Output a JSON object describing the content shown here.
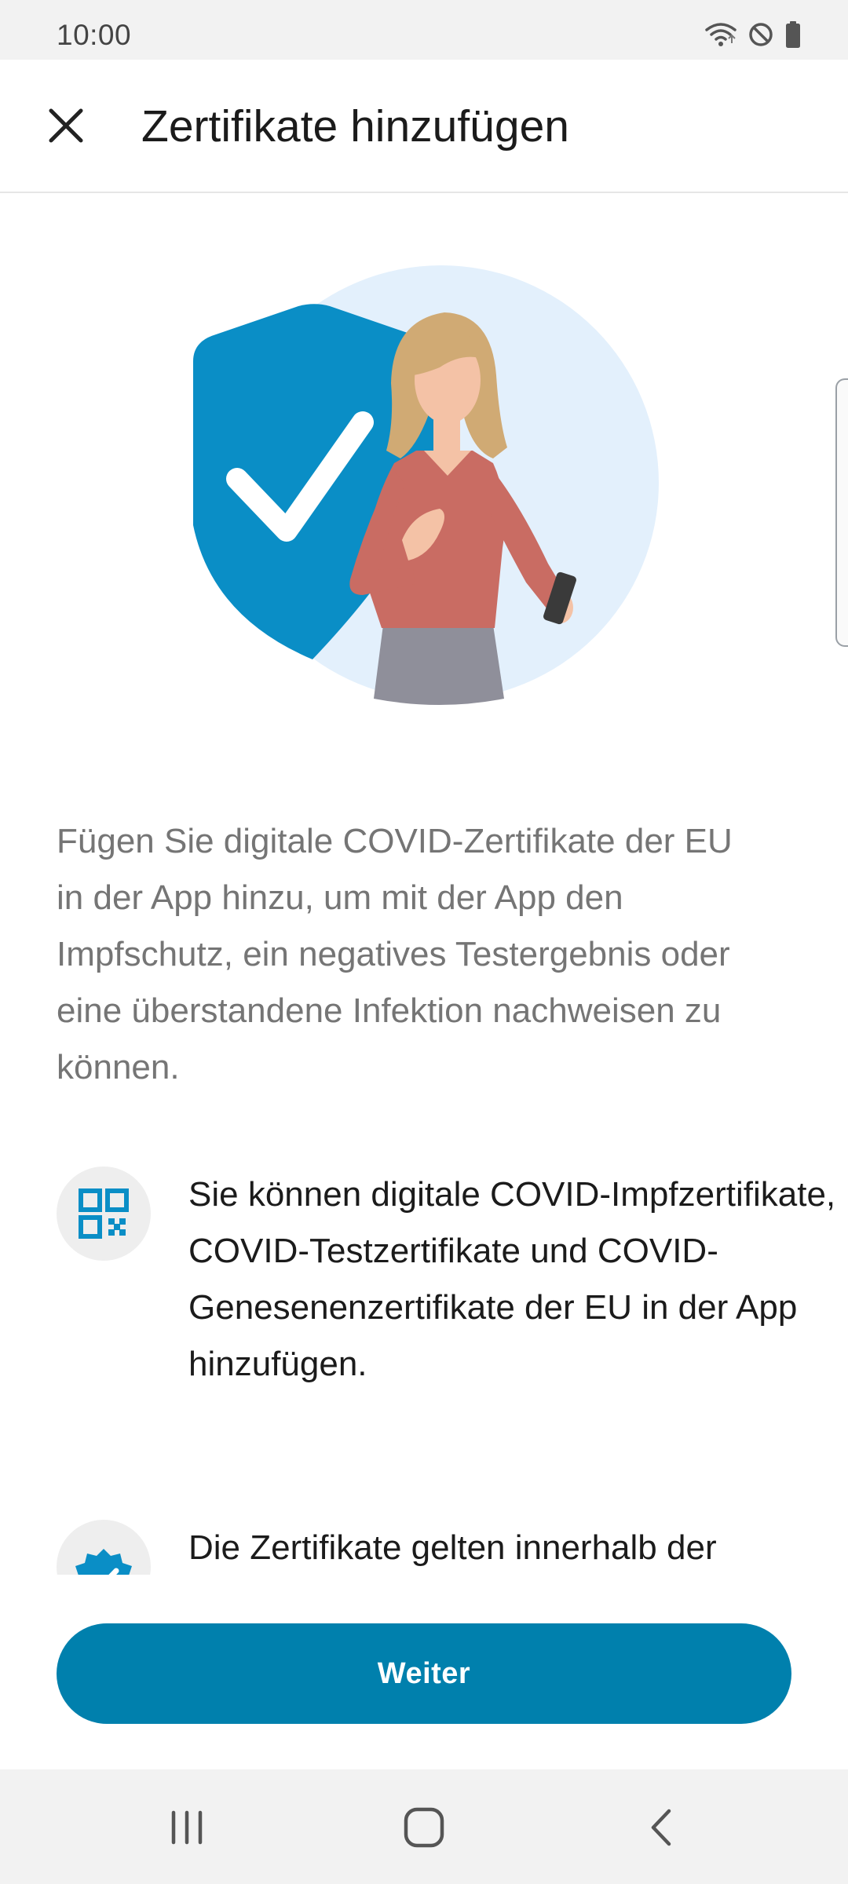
{
  "status_bar": {
    "time": "10:00",
    "icons": [
      "wifi-icon",
      "do-not-disturb-icon",
      "battery-icon"
    ]
  },
  "app_bar": {
    "title": "Zertifikate hinzufügen",
    "close_icon": "close-icon"
  },
  "content": {
    "intro": "Fügen Sie digitale COVID-Zertifikate der EU in der App hinzu, um mit der App den Impfschutz, ein negatives Testergebnis oder eine überstandene Infektion nachweisen zu können.",
    "items": [
      {
        "icon": "qr-code-icon",
        "text": "Sie können digitale COVID-Impfzertifikate, COVID-Testzertifikate und COVID-Genesenenzertifikate der EU in der App hinzufügen."
      },
      {
        "icon": "verified-badge-icon",
        "text": "Die Zertifikate gelten innerhalb der"
      }
    ]
  },
  "footer": {
    "continue_label": "Weiter"
  },
  "navigation": [
    "recent-apps-icon",
    "home-icon",
    "back-icon"
  ],
  "colors": {
    "accent": "#0080ad",
    "shield": "#0a8ec6",
    "illustration_bg": "#e3f0fc",
    "body_text": "#757575",
    "status_bar_bg": "#f2f2f2"
  }
}
